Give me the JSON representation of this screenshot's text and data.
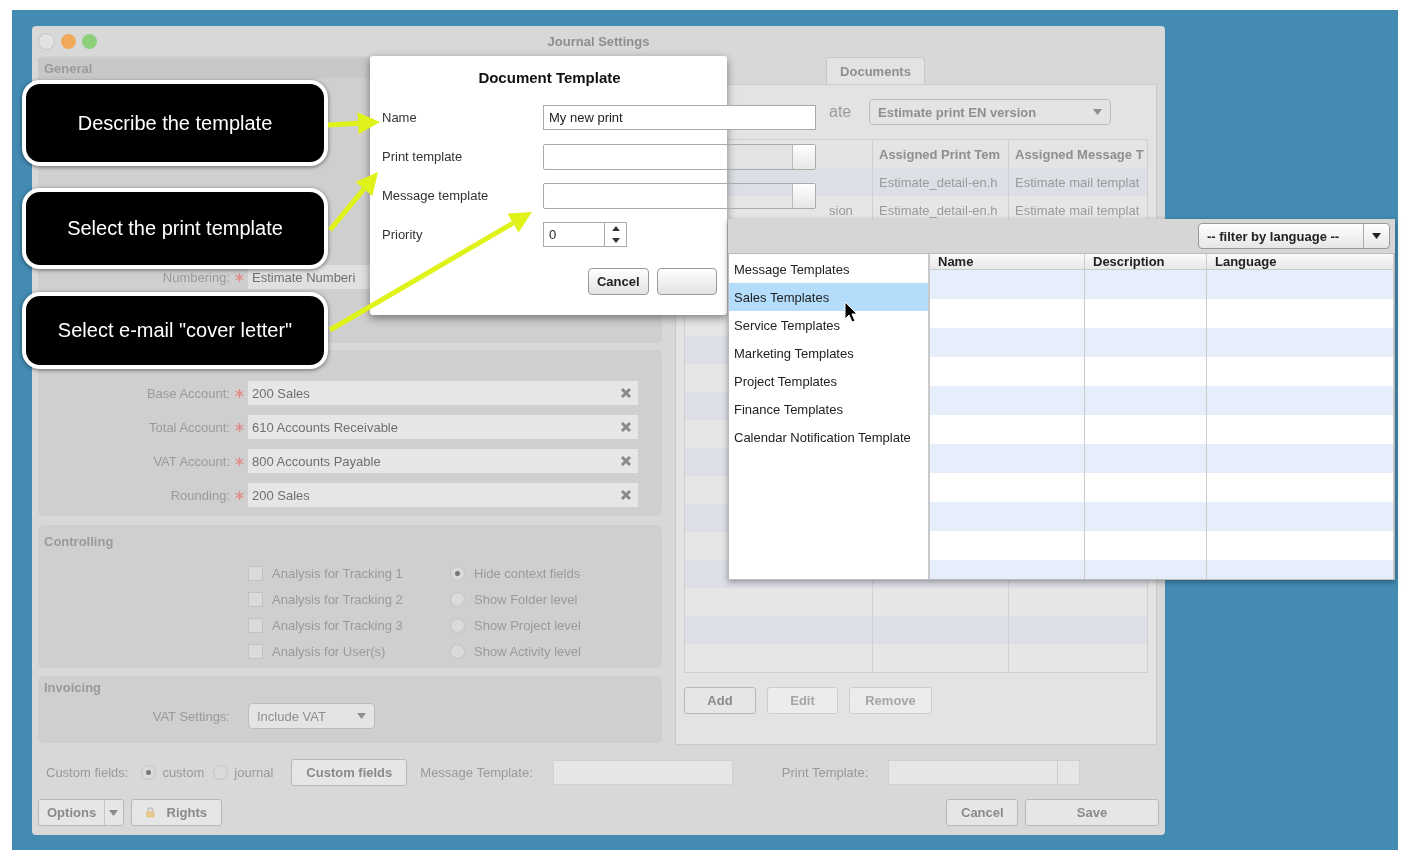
{
  "window": {
    "title": "Journal Settings"
  },
  "general": {
    "header": "General",
    "numbering": {
      "label": "Numbering:",
      "required": true,
      "value": "Estimate Numberi"
    }
  },
  "accounts": [
    {
      "label": "Base Account:",
      "required": true,
      "value": "200 Sales"
    },
    {
      "label": "Total Account:",
      "required": true,
      "value": "610 Accounts Receivable"
    },
    {
      "label": "VAT Account:",
      "required": true,
      "value": "800 Accounts Payable"
    },
    {
      "label": "Rounding:",
      "required": true,
      "value": "200 Sales"
    }
  ],
  "controlling": {
    "header": "Controlling",
    "checkboxes": [
      {
        "label": "Analysis for Tracking 1",
        "checked": false
      },
      {
        "label": "Analysis for Tracking 2",
        "checked": false
      },
      {
        "label": "Analysis for Tracking 3",
        "checked": false
      },
      {
        "label": "Analysis for User(s)",
        "checked": false
      }
    ],
    "radios": [
      {
        "label": "Hide context fields",
        "selected": true
      },
      {
        "label": "Show Folder level",
        "selected": false
      },
      {
        "label": "Show Project level",
        "selected": false
      },
      {
        "label": "Show Activity level",
        "selected": false
      }
    ]
  },
  "invoicing": {
    "header": "Invoicing",
    "vat_label": "VAT Settings:",
    "vat_value": "Include VAT"
  },
  "custom_fields": {
    "label": "Custom fields:",
    "options": [
      {
        "label": "custom",
        "selected": true
      },
      {
        "label": "journal",
        "selected": false
      }
    ],
    "button": "Custom fields",
    "message_template_label": "Message Template:",
    "print_template_label": "Print Template:"
  },
  "footer": {
    "options": "Options",
    "rights": "Rights",
    "cancel": "Cancel",
    "save": "Save"
  },
  "documents": {
    "tab": "Documents",
    "template_label": "ate",
    "template_value": "Estimate print EN version",
    "columns": [
      "Assigned Print Tem",
      "Assigned Message T"
    ],
    "rows": [
      {
        "cells": [
          "Estimate_detail-en.h",
          "Estimate mail templat"
        ]
      },
      {
        "column_1": "sion",
        "cells": [
          "Estimate_detail-en.h",
          "Estimate mail templat"
        ]
      }
    ],
    "buttons": [
      {
        "label": "Add",
        "disabled": false
      },
      {
        "label": "Edit",
        "disabled": true
      },
      {
        "label": "Remove",
        "disabled": true
      }
    ]
  },
  "dialog": {
    "title": "Document Template",
    "fields": [
      {
        "label": "Name",
        "kind": "text",
        "value": "My new print"
      },
      {
        "label": "Print template",
        "kind": "picker"
      },
      {
        "label": "Message template",
        "kind": "picker"
      },
      {
        "label": "Priority",
        "kind": "spinner",
        "value": "0"
      }
    ],
    "buttons": [
      "Cancel"
    ]
  },
  "popup": {
    "filter": "-- filter by language --",
    "categories": [
      {
        "label": "Message Templates",
        "selected": false
      },
      {
        "label": "Sales Templates",
        "selected": true
      },
      {
        "label": "Service Templates",
        "selected": false
      },
      {
        "label": "Marketing Templates",
        "selected": false
      },
      {
        "label": "Project Templates",
        "selected": false
      },
      {
        "label": "Finance Templates",
        "selected": false
      },
      {
        "label": "Calendar Notification Template",
        "selected": false
      }
    ],
    "columns": [
      "Name",
      "Description",
      "Language"
    ]
  },
  "callouts": [
    "Describe the template",
    "Select the print template",
    "Select e-mail \"cover letter\""
  ]
}
